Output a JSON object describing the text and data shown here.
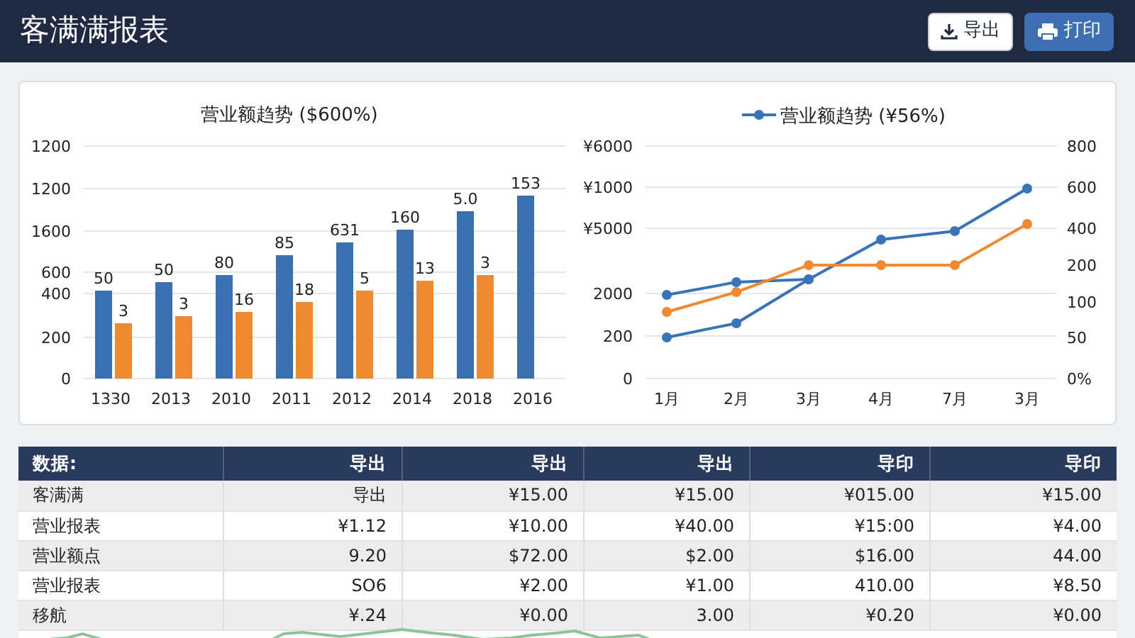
{
  "header": {
    "title": "客满满报表",
    "buttons": [
      {
        "label": "导出",
        "kind": "export"
      },
      {
        "label": "打印",
        "kind": "print"
      }
    ]
  },
  "charts": [
    {
      "kind": "bar",
      "title": "营业额趋势 ($600%)",
      "y_axis_labels": [
        "1200",
        "1200",
        "1600",
        "600",
        "400",
        "200",
        "0"
      ],
      "x_axis_labels": [
        "1330",
        "2013",
        "2010",
        "2011",
        "2012",
        "2014",
        "2018",
        "2016"
      ],
      "bar_labels": [
        [
          "50",
          "3"
        ],
        [
          "50",
          "3"
        ],
        [
          "80",
          "16"
        ],
        [
          "85",
          "18"
        ],
        [
          "631",
          "5"
        ],
        [
          "160",
          "13"
        ],
        [
          "5.0",
          "3"
        ],
        [
          "153"
        ]
      ]
    },
    {
      "kind": "line",
      "legend": "营业额趋势 (¥56%)",
      "y_axis_labels": [
        "¥6000",
        "¥1000",
        "¥5000",
        "2000",
        "200",
        "0"
      ],
      "right_axis_labels": [
        "800",
        "600",
        "400",
        "200",
        "100",
        "50",
        "0%"
      ],
      "x_axis_labels": [
        "1月",
        "2月",
        "3月",
        "4月",
        "7月",
        "3月"
      ]
    }
  ],
  "table": {
    "columns": [
      "数据:",
      "导出",
      "导出",
      "导出",
      "导印",
      "导印"
    ],
    "rows": [
      [
        "客满满",
        "导出",
        "¥15.00",
        "¥15.00",
        "¥015.00",
        "¥15.00"
      ],
      [
        "营业报表",
        "¥1.12",
        "¥10.00",
        "¥40.00",
        "¥15:00",
        "¥4.00"
      ],
      [
        "营业额点",
        "9.20",
        "$72.00",
        "$2.00",
        "$16.00",
        "44.00"
      ],
      [
        "营业报表",
        "SO6",
        "¥2.00",
        "¥1.00",
        "410.00",
        "¥8.50"
      ],
      [
        "移航",
        "¥.24",
        "¥0.00",
        "3.00",
        "¥0.20",
        "¥0.00"
      ]
    ]
  }
}
